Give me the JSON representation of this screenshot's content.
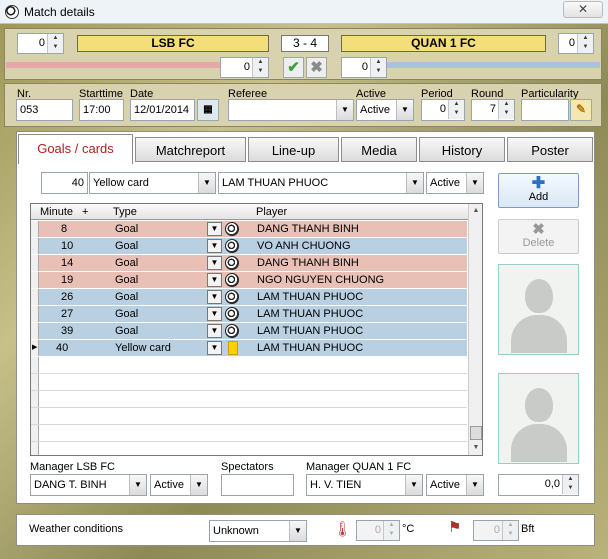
{
  "window": {
    "title": "Match details",
    "close": "✕"
  },
  "score": {
    "home_num": "0",
    "away_num": "0",
    "home_team": "LSB FC",
    "away_team": "QUAN 1 FC",
    "home_goals": "3",
    "sep": "-",
    "away_goals": "4",
    "home_extra": "0",
    "away_extra": "0",
    "colors": {
      "home_bar": "#e8a8a8",
      "away_bar": "#a9c3df",
      "confirm": "#3aa13a",
      "cancel": "#8a8a8a"
    }
  },
  "info": {
    "nr_label": "Nr.",
    "nr": "053",
    "starttime_label": "Starttime",
    "starttime": "17:00",
    "date_label": "Date",
    "date": "12/01/2014",
    "referee_label": "Referee",
    "referee": "",
    "active_label": "Active",
    "active": "Active",
    "period_label": "Period",
    "period": "0",
    "round_label": "Round",
    "round": "7",
    "particularity_label": "Particularity",
    "particularity": ""
  },
  "tabs": [
    "Goals / cards",
    "Matchreport",
    "Line-up",
    "Media",
    "History",
    "Poster"
  ],
  "entry": {
    "minute": "40",
    "event": "Yellow card",
    "player": "LAM THUAN PHUOC",
    "status": "Active"
  },
  "grid": {
    "headers": {
      "minute": "Minute",
      "plus": "+",
      "type": "Type",
      "player": "Player"
    },
    "row_colors": {
      "home": "#e8c0b6",
      "away": "#b8d0e2"
    },
    "rows": [
      {
        "minute": "8",
        "type": "Goal",
        "player": "DANG THANH BINH",
        "side": "home",
        "icon": "ball"
      },
      {
        "minute": "10",
        "type": "Goal",
        "player": "VO ANH CHUONG",
        "side": "away",
        "icon": "ball"
      },
      {
        "minute": "14",
        "type": "Goal",
        "player": "DANG THANH BINH",
        "side": "home",
        "icon": "ball"
      },
      {
        "minute": "19",
        "type": "Goal",
        "player": "NGO NGUYEN CHUONG",
        "side": "home",
        "icon": "ball"
      },
      {
        "minute": "26",
        "type": "Goal",
        "player": "LAM THUAN PHUOC",
        "side": "away",
        "icon": "ball"
      },
      {
        "minute": "27",
        "type": "Goal",
        "player": "LAM THUAN PHUOC",
        "side": "away",
        "icon": "ball"
      },
      {
        "minute": "39",
        "type": "Goal",
        "player": "LAM THUAN PHUOC",
        "side": "away",
        "icon": "ball"
      },
      {
        "minute": "40",
        "type": "Yellow card",
        "player": "LAM THUAN PHUOC",
        "side": "away",
        "icon": "card"
      }
    ]
  },
  "buttons": {
    "add": "Add",
    "delete": "Delete"
  },
  "managers": {
    "home_label": "Manager LSB FC",
    "home": "DANG T. BINH",
    "home_status": "Active",
    "spectators_label": "Spectators",
    "spectators": "",
    "away_label": "Manager QUAN 1 FC",
    "away": "H. V. TIEN",
    "away_status": "Active",
    "rating": "0,0"
  },
  "weather": {
    "label": "Weather conditions",
    "value": "Unknown",
    "temp": "0",
    "temp_unit": "°C",
    "wind": "0",
    "wind_unit": "Bft"
  }
}
